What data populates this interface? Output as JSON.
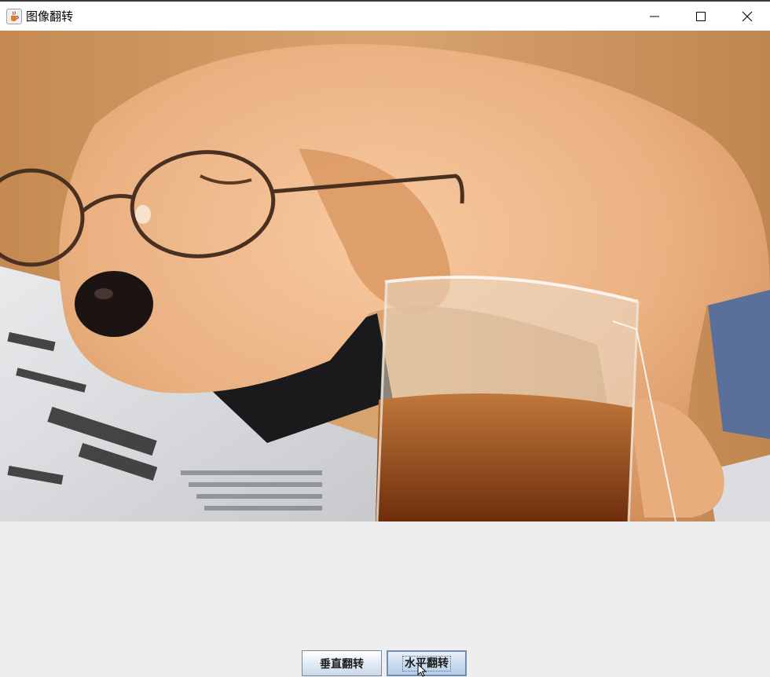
{
  "window": {
    "title": "图像翻转",
    "app_icon": "java-cup-icon",
    "controls": [
      "minimize-icon",
      "maximize-icon",
      "close-icon"
    ]
  },
  "image": {
    "content": "puppy-sleeping-with-glasses-and-tea"
  },
  "buttons": {
    "vertical_flip": "垂直翻转",
    "horizontal_flip": "水平翻转"
  },
  "colors": {
    "background": "#eeeeee",
    "titlebar": "#ffffff",
    "fur": "#e8a878",
    "tea": "#9a4a1a"
  }
}
